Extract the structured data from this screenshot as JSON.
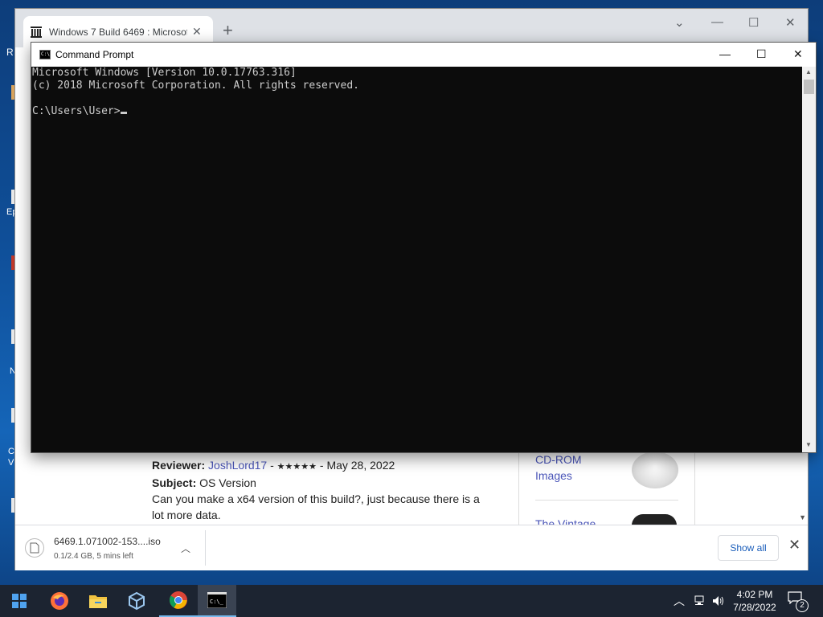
{
  "browser": {
    "tab_title": "Windows 7 Build 6469 : Microsof",
    "review": {
      "reviewer_label": "Reviewer:",
      "reviewer_name": "JoshLord17",
      "sep1": " - ",
      "stars": "★★★★★",
      "sep2": " - ",
      "date": "May 28, 2022",
      "subject_label": "Subject:",
      "subject": "OS Version",
      "body": "Can you make a x64 version of this build?, just because there is a lot more data."
    },
    "sidebar_links": [
      "CD-ROM",
      "Images",
      "The Vintage"
    ],
    "download": {
      "filename": "6469.1.071002-153....iso",
      "status": "0.1/2.4 GB, 5 mins left",
      "show_all_label": "Show all"
    }
  },
  "cmd": {
    "title": "Command Prompt",
    "lines": [
      "Microsoft Windows [Version 10.0.17763.316]",
      "(c) 2018 Microsoft Corporation. All rights reserved.",
      "",
      "C:\\Users\\User>"
    ]
  },
  "taskbar": {
    "apps": [
      "start-icon",
      "firefox-icon",
      "file-explorer-icon",
      "virtualbox-icon",
      "chrome-icon",
      "command-prompt-icon"
    ],
    "time": "4:02 PM",
    "date": "7/28/2022",
    "notification_count": "2"
  }
}
